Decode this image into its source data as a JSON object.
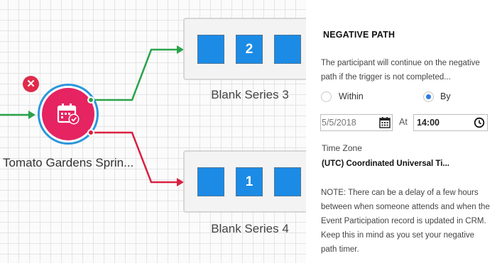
{
  "canvas": {
    "event": {
      "label": "Tomato Gardens Sprin...",
      "remove_icon": "close-icon",
      "icon": "calendar-check-icon"
    },
    "series": [
      {
        "label": "Blank Series 3",
        "badge": "2"
      },
      {
        "label": "Blank Series 4",
        "badge": "1"
      }
    ],
    "colors": {
      "positive_path": "#2aa34a",
      "negative_path": "#d92040",
      "tile": "#1b8be6",
      "event": "#e52461"
    }
  },
  "panel": {
    "title": "NEGATIVE PATH",
    "description": "The participant will continue on the negative path if the trigger is not completed...",
    "options": {
      "within_label": "Within",
      "by_label": "By",
      "selected": "By"
    },
    "date_value": "5/5/2018",
    "at_label": "At",
    "time_value": "14:00",
    "timezone_label": "Time Zone",
    "timezone_value": "(UTC) Coordinated Universal Ti...",
    "note": "NOTE: There can be a delay of a few hours between when someone attends and when the Event Participation record is updated in CRM. Keep this in mind as you set your negative path timer."
  }
}
